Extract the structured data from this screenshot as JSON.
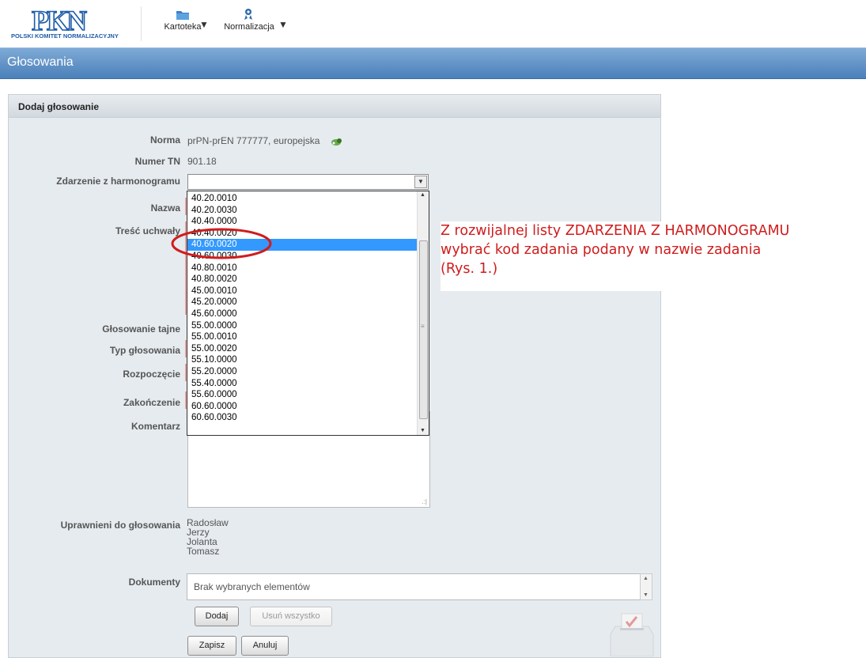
{
  "header": {
    "logo_text": "PKN",
    "logo_subtitle": "POLSKI KOMITET NORMALIZACYJNY",
    "menu": [
      {
        "label": "Kartoteka",
        "icon": "folder-icon"
      },
      {
        "label": "Normalizacja",
        "icon": "standardization-icon"
      }
    ]
  },
  "page_title": "Głosowania",
  "panel": {
    "title": "Dodaj głosowanie",
    "labels": {
      "norma": "Norma",
      "numer_tn": "Numer TN",
      "zdarzenie": "Zdarzenie z harmonogramu",
      "nazwa": "Nazwa",
      "tresc": "Treść uchwały",
      "tajne": "Głosowanie tajne",
      "typ": "Typ głosowania",
      "rozpoczecie": "Rozpoczęcie",
      "zakonczenie": "Zakończenie",
      "komentarz": "Komentarz",
      "uprawnieni": "Uprawnieni do głosowania",
      "dokumenty": "Dokumenty"
    },
    "values": {
      "norma": "prPN-prEN 777777, europejska",
      "numer_tn": "901.18",
      "zdarzenie_selected": "",
      "dokumenty_placeholder": "Brak wybranych elementów"
    },
    "voters": [
      "Radosław",
      "Jerzy",
      "Jolanta",
      "Tomasz"
    ],
    "dropdown_options": [
      "40.20.0010",
      "40.20.0030",
      "40.40.0000",
      "40.40.0020",
      "40.60.0020",
      "40.60.0030",
      "40.80.0010",
      "40.80.0020",
      "45.00.0010",
      "45.20.0000",
      "45.60.0000",
      "55.00.0000",
      "55.00.0010",
      "55.00.0020",
      "55.10.0000",
      "55.20.0000",
      "55.40.0000",
      "55.60.0000",
      "60.60.0000",
      "60.60.0030"
    ],
    "dropdown_highlighted_index": 4,
    "buttons": {
      "dodaj": "Dodaj",
      "usun": "Usuń wszystko",
      "zapisz": "Zapisz",
      "anuluj": "Anuluj"
    }
  },
  "annotation": {
    "lines": [
      "Z rozwijalnej listy ZDARZENIA Z HARMONOGRAMU",
      "wybrać kod zadania podany w nazwie zadania",
      "(Rys. 1.)"
    ],
    "color": "#d01c1c"
  },
  "colors": {
    "titlebar": "#5b8cc2",
    "selection": "#3399ff",
    "required_marker": "#e3a0a0"
  }
}
